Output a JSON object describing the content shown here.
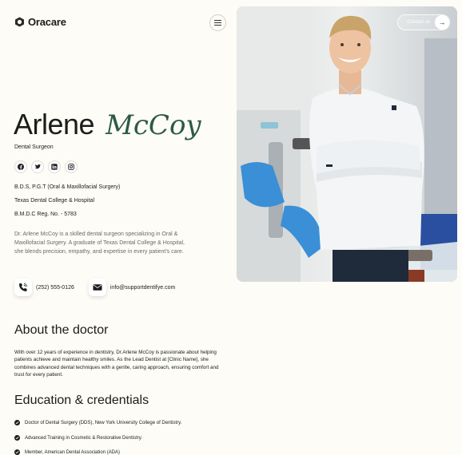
{
  "brand": {
    "name": "Oracare"
  },
  "header": {
    "contact_label": "Contact us"
  },
  "profile": {
    "first_name": "Arlene",
    "last_name": "McCoy",
    "role": "Dental Surgeon",
    "credentials": [
      "B.D.S, P.G.T (Oral & Maxillofacial Surgery)",
      "Texas Dental College & Hospital",
      "B.M.D.C Reg. No. - 5783"
    ],
    "bio": "Dr. Arlene McCoy is a skilled dental surgeon specializing in Oral & Maxillofacial Surgery. A graduate of Texas Dental College & Hospital, she blends precision, empathy, and expertise in every patient's care.",
    "phone": "(252) 555-0126",
    "email": "info@supportdentifye.com"
  },
  "about": {
    "heading": "About the doctor",
    "text": "With over 12 years of experience in dentistry, Dr.Arlene McCoy is passionate about helping patients achieve and maintain healthy smiles. As the Lead Dentist at [Clinic Name], she combines advanced dental techniques with a gentle, caring approach, ensuring comfort and trust for every patient."
  },
  "education": {
    "heading": "Education & credentials",
    "items": [
      "Doctor of Dental Surgery (DDS), New York University College of Dentistry.",
      "Advanced Training in Cosmetic & Restorative Dentistry.",
      "Member, American Dental Association (ADA)"
    ]
  },
  "colors": {
    "accent": "#2d5a43",
    "background": "#fdfcf6",
    "text": "#1b1d1a"
  },
  "icons": [
    "logo-mark-icon",
    "menu-icon",
    "arrow-right-icon",
    "facebook-icon",
    "twitter-icon",
    "linkedin-icon",
    "instagram-icon",
    "phone-icon",
    "mail-icon",
    "check-icon"
  ]
}
